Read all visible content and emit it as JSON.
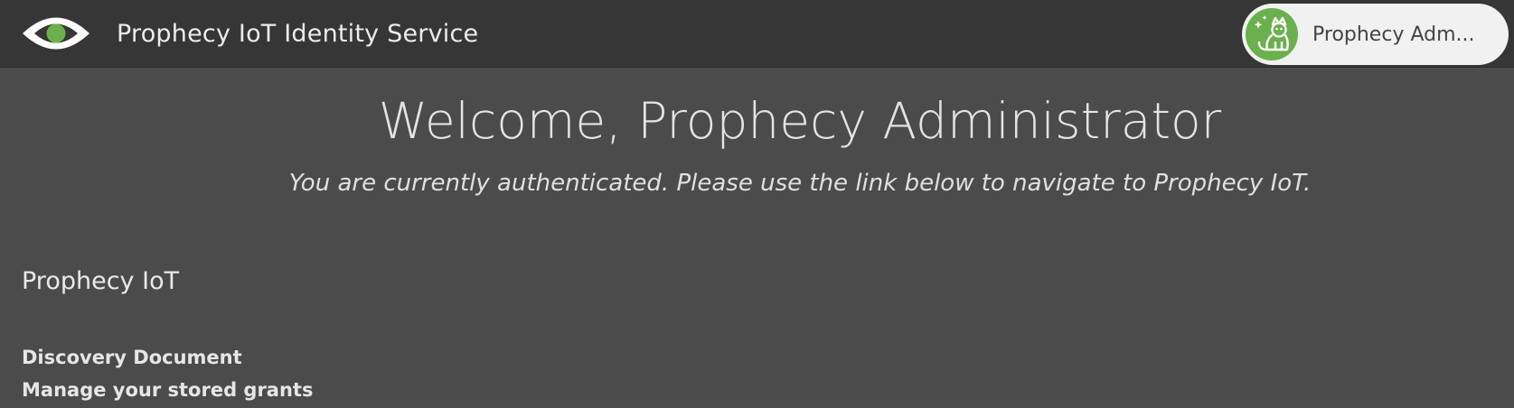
{
  "header": {
    "app_title": "Prophecy IoT Identity Service",
    "logo_icon": "eye-icon",
    "brand_color": "#6ab04c",
    "user": {
      "display_name": "Prophecy Adm...",
      "avatar_icon": "cat-avatar-icon"
    }
  },
  "main": {
    "welcome_title": "Welcome, Prophecy Administrator",
    "subtitle": "You are currently authenticated. Please use the link below to navigate to Prophecy IoT.",
    "app_link": "Prophecy IoT"
  },
  "footer": {
    "links": [
      "Discovery Document",
      "Manage your stored grants"
    ]
  }
}
